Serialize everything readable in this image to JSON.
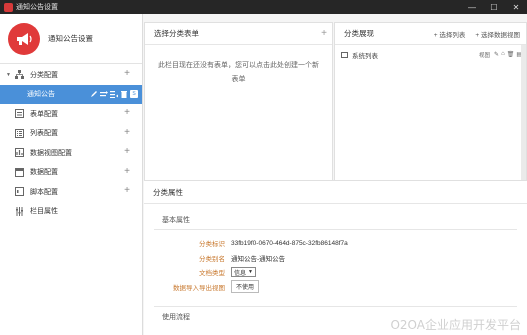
{
  "window": {
    "title": "通知公告设置",
    "controls": {
      "minimize": "—",
      "maximize": "☐",
      "close": "✕"
    }
  },
  "sidebar": {
    "title": "通知公告设置",
    "items": [
      {
        "label": "分类配置",
        "icon": "org-tree-icon",
        "expandable": true
      },
      {
        "label": "通知公告",
        "selected": true
      },
      {
        "label": "表单配置",
        "icon": "form-icon"
      },
      {
        "label": "列表配置",
        "icon": "list-icon"
      },
      {
        "label": "数据视图配置",
        "icon": "view-icon"
      },
      {
        "label": "数据配置",
        "icon": "data-icon"
      },
      {
        "label": "脚本配置",
        "icon": "script-icon"
      },
      {
        "label": "栏目属性",
        "icon": "sliders-icon"
      }
    ],
    "plus": "+",
    "badge": "S"
  },
  "form_panel": {
    "title": "选择分类表单",
    "empty_text": "此栏目现在还没有表单，您可以点击此处创建一个新表单",
    "plus": "+"
  },
  "view_panel": {
    "title": "分类展现",
    "select_list": "选择列表",
    "select_dataview": "选择数据视图",
    "items": [
      {
        "label": "系统列表",
        "tag": "视图"
      }
    ]
  },
  "attributes": {
    "title": "分类属性",
    "basic_section": "基本属性",
    "rows": [
      {
        "label": "分类标识",
        "value": "33fb19f0-0670-464d-875c-32fb86148f7a"
      },
      {
        "label": "分类别名",
        "value": "通知公告-通知公告"
      },
      {
        "label": "文档类型",
        "value": "信息"
      },
      {
        "label": "数据导入导出视图",
        "value": "不使用"
      }
    ],
    "flow_section": "使用流程",
    "watermark": "O2OA企业应用开发平台"
  }
}
